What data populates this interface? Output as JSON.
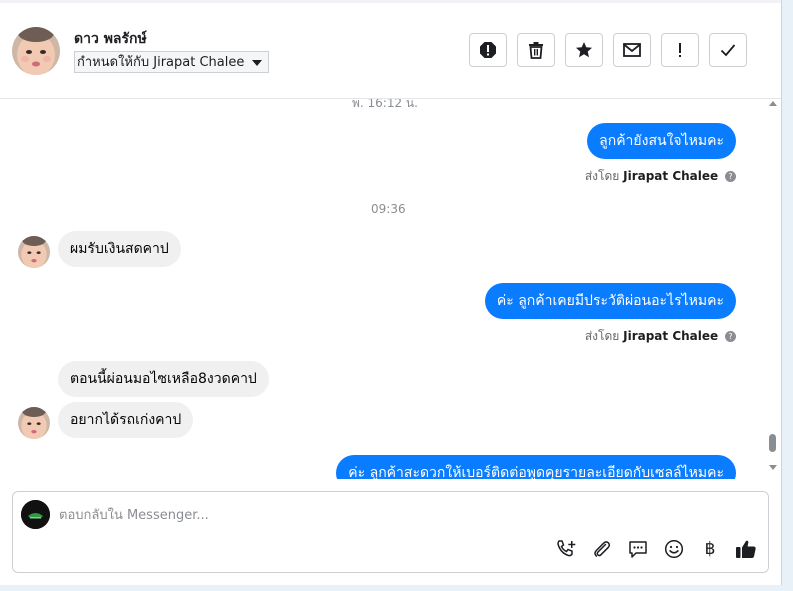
{
  "header": {
    "contact_name": "ดาว พลรักษ์",
    "assign_label": "กำหนดให้กับ Jirapat Chalee",
    "actions": [
      "spam-icon",
      "trash-icon",
      "star-icon",
      "envelope-icon",
      "exclamation-icon",
      "check-icon"
    ]
  },
  "thread": {
    "timestamp_prev": "พ. 16:12 น.",
    "timestamp_today": "09:36",
    "sent_by_prefix": "ส่งโดย",
    "sent_by_name": "Jirapat Chalee",
    "messages": [
      {
        "from": "page",
        "text": "ลูกค้ายังสนใจไหมคะ"
      },
      {
        "from": "customer",
        "text": "ผมรับเงินสดคาป"
      },
      {
        "from": "page",
        "text": "ค่ะ ลูกค้าเคยมีประวัติผ่อนอะไรไหมคะ"
      },
      {
        "from": "customer",
        "text": "ตอนนี้ผ่อนมอไซเหลือ8งวดคาป"
      },
      {
        "from": "customer",
        "text": "อยากได้รถเก่งคาป"
      },
      {
        "from": "page",
        "text": "ค่ะ ลูกค้าสะดวกให้เบอร์ติดต่อพูดคุยรายละเอียดกับเซลล์ไหมคะ"
      }
    ]
  },
  "composer": {
    "placeholder": "ตอบกลับใน Messenger...",
    "value": "",
    "tools": [
      "call-add-icon",
      "attachment-icon",
      "saved-reply-icon",
      "emoji-icon",
      "baht-icon",
      "like-icon"
    ],
    "baht_symbol": "฿"
  },
  "colors": {
    "outgoing_bubble": "#0a7cff",
    "incoming_bubble": "#f0f0f0",
    "background": "#e8f1f8"
  }
}
